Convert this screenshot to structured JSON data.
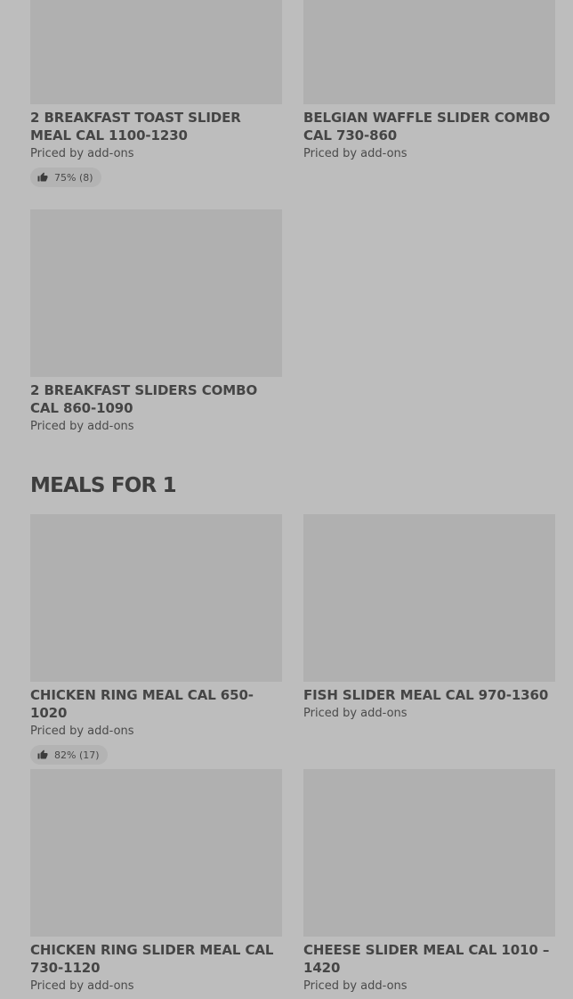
{
  "top_items": [
    {
      "name": "2 BREAKFAST TOAST SLIDER MEAL CAL 1100-1230",
      "price": "Priced by add-ons",
      "rating": "75% (8)"
    },
    {
      "name": "BELGIAN WAFFLE SLIDER COMBO CAL 730-860",
      "price": "Priced by add-ons"
    },
    {
      "name": "2 BREAKFAST SLIDERS COMBO CAL 860-1090",
      "price": "Priced by add-ons"
    }
  ],
  "section": {
    "title": "MEALS FOR 1"
  },
  "meals": [
    {
      "name": "CHICKEN RING MEAL CAL 650-1020",
      "price": "Priced by add-ons",
      "rating": "82% (17)"
    },
    {
      "name": "FISH SLIDER MEAL CAL 970-1360",
      "price": "Priced by add-ons"
    },
    {
      "name": "CHICKEN RING SLIDER MEAL CAL 730-1120",
      "price": "Priced by add-ons"
    },
    {
      "name": "CHEESE SLIDER MEAL CAL 1010 – 1420",
      "price": "Priced by add-ons"
    }
  ],
  "icons": {
    "rating": "thumbs-up-icon"
  },
  "colors": {
    "background": "#bdbdbd",
    "placeholder": "#b0b0b0",
    "text": "#3f3f3f"
  }
}
